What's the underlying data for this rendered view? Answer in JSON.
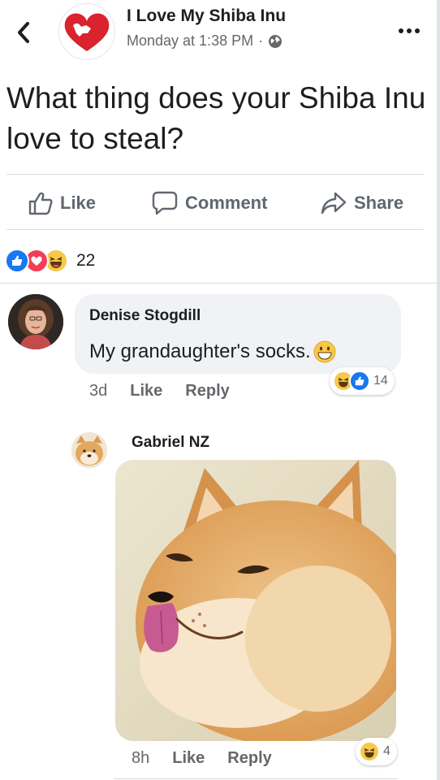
{
  "header": {
    "back_icon": "chevron-left-icon",
    "page_name": "I Love My Shiba Inu",
    "timestamp": "Monday at 1:38 PM",
    "separator": "·",
    "privacy_icon": "globe-icon",
    "more_icon": "more-dots-icon"
  },
  "post": {
    "text": "What thing does your Shiba Inu love to steal?"
  },
  "actions": {
    "like": "Like",
    "comment": "Comment",
    "share": "Share"
  },
  "reactions": {
    "types": [
      "like",
      "love",
      "haha"
    ],
    "count": "22"
  },
  "comments": [
    {
      "author": "Denise Stogdill",
      "text": "My grandaughter's socks.",
      "emoji": "grinning-face-icon",
      "time": "3d",
      "like_label": "Like",
      "reply_label": "Reply",
      "reactions": [
        "haha",
        "like"
      ],
      "reaction_count": "14"
    }
  ],
  "replies": [
    {
      "author": "Gabriel NZ",
      "image": "shiba-inu-tongue-out-photo",
      "time": "8h",
      "like_label": "Like",
      "reply_label": "Reply",
      "reactions": [
        "haha"
      ],
      "reaction_count": "4"
    }
  ],
  "colors": {
    "facebook_blue": "#1877f2",
    "love_red": "#f33e58",
    "haha_yellow": "#f7c84a",
    "brand_red": "#d9232e",
    "secondary_text": "#65676b",
    "bubble_bg": "#f0f2f5"
  }
}
